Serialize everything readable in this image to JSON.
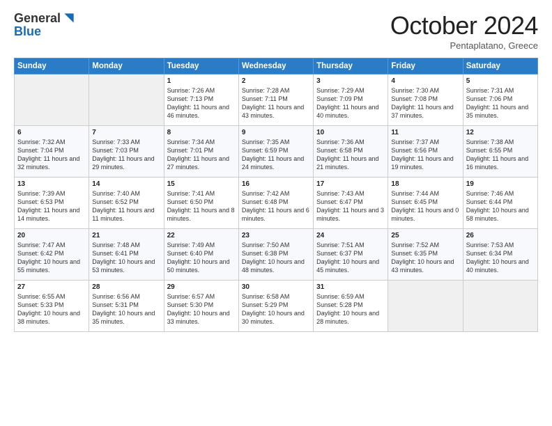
{
  "header": {
    "logo_general": "General",
    "logo_blue": "Blue",
    "month_title": "October 2024",
    "subtitle": "Pentaplatano, Greece"
  },
  "days_of_week": [
    "Sunday",
    "Monday",
    "Tuesday",
    "Wednesday",
    "Thursday",
    "Friday",
    "Saturday"
  ],
  "weeks": [
    [
      {
        "day": "",
        "sunrise": "",
        "sunset": "",
        "daylight": ""
      },
      {
        "day": "",
        "sunrise": "",
        "sunset": "",
        "daylight": ""
      },
      {
        "day": "1",
        "sunrise": "Sunrise: 7:26 AM",
        "sunset": "Sunset: 7:13 PM",
        "daylight": "Daylight: 11 hours and 46 minutes."
      },
      {
        "day": "2",
        "sunrise": "Sunrise: 7:28 AM",
        "sunset": "Sunset: 7:11 PM",
        "daylight": "Daylight: 11 hours and 43 minutes."
      },
      {
        "day": "3",
        "sunrise": "Sunrise: 7:29 AM",
        "sunset": "Sunset: 7:09 PM",
        "daylight": "Daylight: 11 hours and 40 minutes."
      },
      {
        "day": "4",
        "sunrise": "Sunrise: 7:30 AM",
        "sunset": "Sunset: 7:08 PM",
        "daylight": "Daylight: 11 hours and 37 minutes."
      },
      {
        "day": "5",
        "sunrise": "Sunrise: 7:31 AM",
        "sunset": "Sunset: 7:06 PM",
        "daylight": "Daylight: 11 hours and 35 minutes."
      }
    ],
    [
      {
        "day": "6",
        "sunrise": "Sunrise: 7:32 AM",
        "sunset": "Sunset: 7:04 PM",
        "daylight": "Daylight: 11 hours and 32 minutes."
      },
      {
        "day": "7",
        "sunrise": "Sunrise: 7:33 AM",
        "sunset": "Sunset: 7:03 PM",
        "daylight": "Daylight: 11 hours and 29 minutes."
      },
      {
        "day": "8",
        "sunrise": "Sunrise: 7:34 AM",
        "sunset": "Sunset: 7:01 PM",
        "daylight": "Daylight: 11 hours and 27 minutes."
      },
      {
        "day": "9",
        "sunrise": "Sunrise: 7:35 AM",
        "sunset": "Sunset: 6:59 PM",
        "daylight": "Daylight: 11 hours and 24 minutes."
      },
      {
        "day": "10",
        "sunrise": "Sunrise: 7:36 AM",
        "sunset": "Sunset: 6:58 PM",
        "daylight": "Daylight: 11 hours and 21 minutes."
      },
      {
        "day": "11",
        "sunrise": "Sunrise: 7:37 AM",
        "sunset": "Sunset: 6:56 PM",
        "daylight": "Daylight: 11 hours and 19 minutes."
      },
      {
        "day": "12",
        "sunrise": "Sunrise: 7:38 AM",
        "sunset": "Sunset: 6:55 PM",
        "daylight": "Daylight: 11 hours and 16 minutes."
      }
    ],
    [
      {
        "day": "13",
        "sunrise": "Sunrise: 7:39 AM",
        "sunset": "Sunset: 6:53 PM",
        "daylight": "Daylight: 11 hours and 14 minutes."
      },
      {
        "day": "14",
        "sunrise": "Sunrise: 7:40 AM",
        "sunset": "Sunset: 6:52 PM",
        "daylight": "Daylight: 11 hours and 11 minutes."
      },
      {
        "day": "15",
        "sunrise": "Sunrise: 7:41 AM",
        "sunset": "Sunset: 6:50 PM",
        "daylight": "Daylight: 11 hours and 8 minutes."
      },
      {
        "day": "16",
        "sunrise": "Sunrise: 7:42 AM",
        "sunset": "Sunset: 6:48 PM",
        "daylight": "Daylight: 11 hours and 6 minutes."
      },
      {
        "day": "17",
        "sunrise": "Sunrise: 7:43 AM",
        "sunset": "Sunset: 6:47 PM",
        "daylight": "Daylight: 11 hours and 3 minutes."
      },
      {
        "day": "18",
        "sunrise": "Sunrise: 7:44 AM",
        "sunset": "Sunset: 6:45 PM",
        "daylight": "Daylight: 11 hours and 0 minutes."
      },
      {
        "day": "19",
        "sunrise": "Sunrise: 7:46 AM",
        "sunset": "Sunset: 6:44 PM",
        "daylight": "Daylight: 10 hours and 58 minutes."
      }
    ],
    [
      {
        "day": "20",
        "sunrise": "Sunrise: 7:47 AM",
        "sunset": "Sunset: 6:42 PM",
        "daylight": "Daylight: 10 hours and 55 minutes."
      },
      {
        "day": "21",
        "sunrise": "Sunrise: 7:48 AM",
        "sunset": "Sunset: 6:41 PM",
        "daylight": "Daylight: 10 hours and 53 minutes."
      },
      {
        "day": "22",
        "sunrise": "Sunrise: 7:49 AM",
        "sunset": "Sunset: 6:40 PM",
        "daylight": "Daylight: 10 hours and 50 minutes."
      },
      {
        "day": "23",
        "sunrise": "Sunrise: 7:50 AM",
        "sunset": "Sunset: 6:38 PM",
        "daylight": "Daylight: 10 hours and 48 minutes."
      },
      {
        "day": "24",
        "sunrise": "Sunrise: 7:51 AM",
        "sunset": "Sunset: 6:37 PM",
        "daylight": "Daylight: 10 hours and 45 minutes."
      },
      {
        "day": "25",
        "sunrise": "Sunrise: 7:52 AM",
        "sunset": "Sunset: 6:35 PM",
        "daylight": "Daylight: 10 hours and 43 minutes."
      },
      {
        "day": "26",
        "sunrise": "Sunrise: 7:53 AM",
        "sunset": "Sunset: 6:34 PM",
        "daylight": "Daylight: 10 hours and 40 minutes."
      }
    ],
    [
      {
        "day": "27",
        "sunrise": "Sunrise: 6:55 AM",
        "sunset": "Sunset: 5:33 PM",
        "daylight": "Daylight: 10 hours and 38 minutes."
      },
      {
        "day": "28",
        "sunrise": "Sunrise: 6:56 AM",
        "sunset": "Sunset: 5:31 PM",
        "daylight": "Daylight: 10 hours and 35 minutes."
      },
      {
        "day": "29",
        "sunrise": "Sunrise: 6:57 AM",
        "sunset": "Sunset: 5:30 PM",
        "daylight": "Daylight: 10 hours and 33 minutes."
      },
      {
        "day": "30",
        "sunrise": "Sunrise: 6:58 AM",
        "sunset": "Sunset: 5:29 PM",
        "daylight": "Daylight: 10 hours and 30 minutes."
      },
      {
        "day": "31",
        "sunrise": "Sunrise: 6:59 AM",
        "sunset": "Sunset: 5:28 PM",
        "daylight": "Daylight: 10 hours and 28 minutes."
      },
      {
        "day": "",
        "sunrise": "",
        "sunset": "",
        "daylight": ""
      },
      {
        "day": "",
        "sunrise": "",
        "sunset": "",
        "daylight": ""
      }
    ]
  ]
}
